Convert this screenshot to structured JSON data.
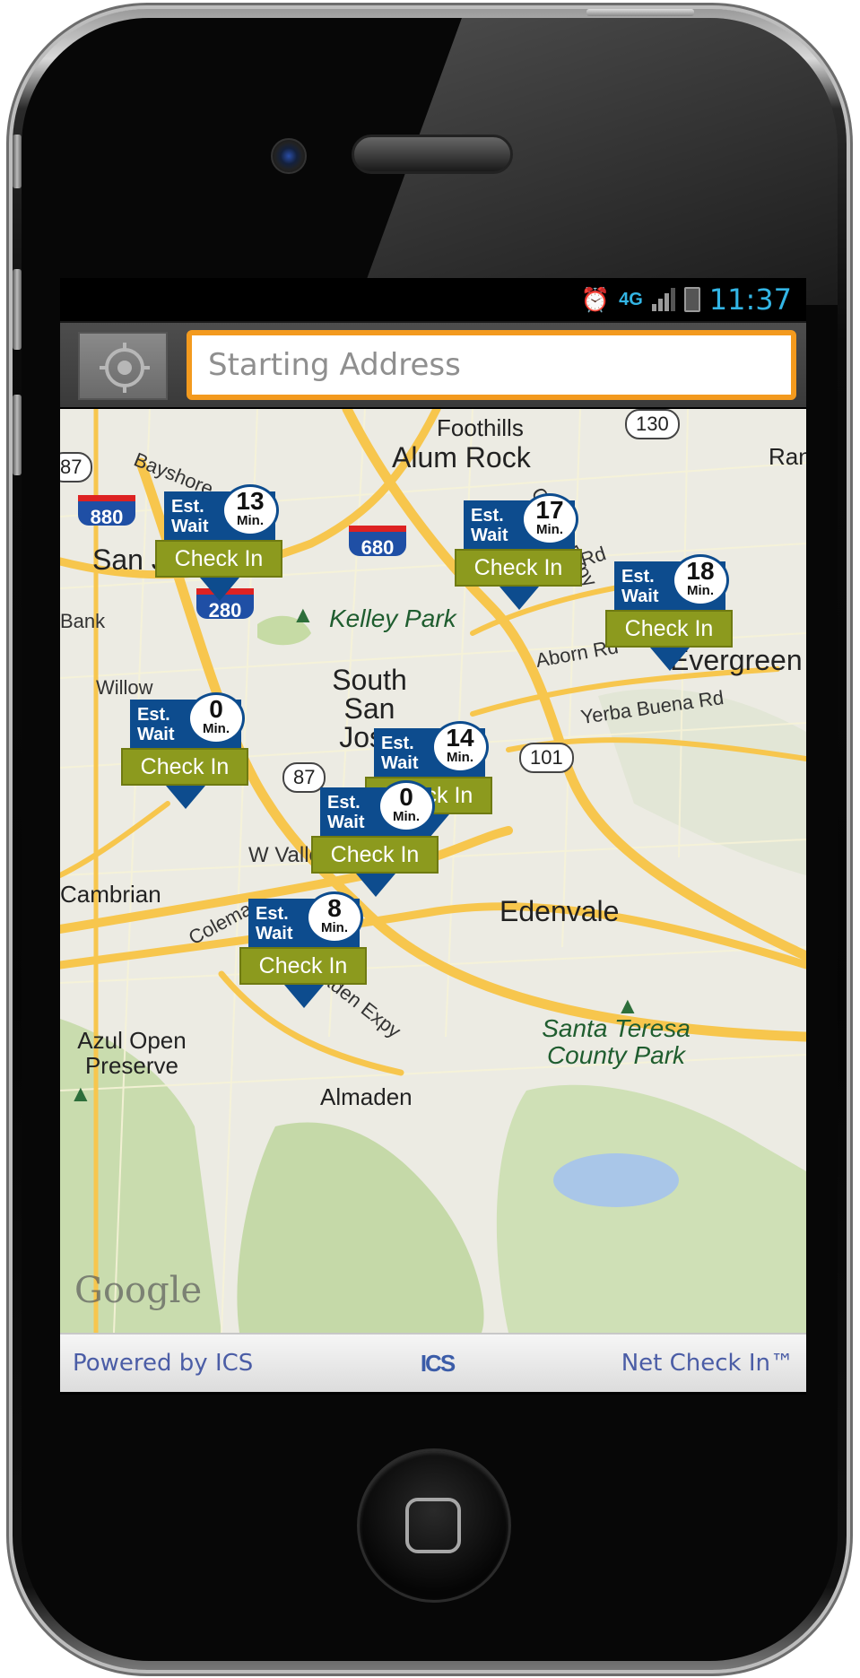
{
  "status_bar": {
    "alarm_icon": "alarm-clock-icon",
    "network": "4G",
    "time": "11:37"
  },
  "search": {
    "placeholder": "Starting Address",
    "locate_icon": "crosshair-locate-icon"
  },
  "map": {
    "places": [
      {
        "name": "Foothills"
      },
      {
        "name": "Alum Rock"
      },
      {
        "name": "San Jose"
      },
      {
        "name": "Kelley Park"
      },
      {
        "name": "South San Jose"
      },
      {
        "name": "Evergreen"
      },
      {
        "name": "Edenvale"
      },
      {
        "name": "Cambrian"
      },
      {
        "name": "Almaden"
      },
      {
        "name": "Santa Teresa County Park"
      },
      {
        "name": "Azul Open Preserve"
      },
      {
        "name": "Rancho"
      }
    ],
    "roads": [
      "Bayshore",
      "Tully Rd",
      "Aborn Rd",
      "Yerba Buena Rd",
      "W Valley Fwy",
      "Almaden Expy",
      "Coleman",
      "Willow",
      "Capitol Expy",
      "Bank"
    ],
    "shields": [
      "880",
      "680",
      "280",
      "130",
      "87",
      "101",
      "87"
    ],
    "attribution": "Google"
  },
  "markers": [
    {
      "est": "Est.",
      "wait": "Wait",
      "minutes": "13",
      "unit": "Min.",
      "action": "Check In"
    },
    {
      "est": "Est.",
      "wait": "Wait",
      "minutes": "17",
      "unit": "Min.",
      "action": "Check In"
    },
    {
      "est": "Est.",
      "wait": "Wait",
      "minutes": "18",
      "unit": "Min.",
      "action": "Check In"
    },
    {
      "est": "Est.",
      "wait": "Wait",
      "minutes": "0",
      "unit": "Min.",
      "action": "Check In"
    },
    {
      "est": "Est.",
      "wait": "Wait",
      "minutes": "14",
      "unit": "Min.",
      "action": "Check In"
    },
    {
      "est": "Est.",
      "wait": "Wait",
      "minutes": "0",
      "unit": "Min.",
      "action": "Check In"
    },
    {
      "est": "Est.",
      "wait": "Wait",
      "minutes": "8",
      "unit": "Min.",
      "action": "Check In"
    }
  ],
  "footer": {
    "powered_by": "Powered by ICS",
    "logo": "ICS",
    "brand": "Net Check In™"
  },
  "colors": {
    "accent_orange": "#f39a1e",
    "marker_blue": "#0d4c8e",
    "checkin_green": "#8c9a1e",
    "status_blue": "#33b5e5"
  }
}
